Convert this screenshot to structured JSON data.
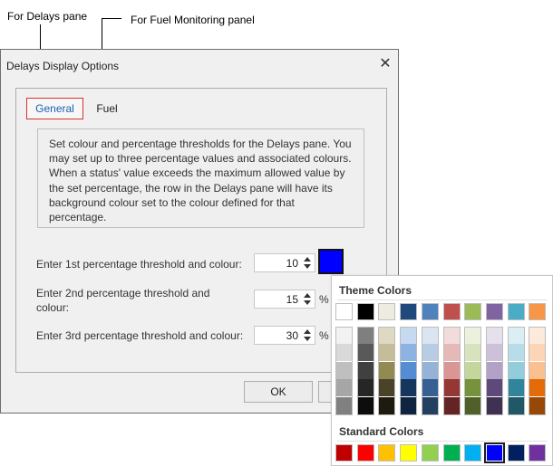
{
  "callouts": {
    "delays": "For Delays pane",
    "fuel": "For Fuel Monitoring panel"
  },
  "dialog": {
    "title": "Delays Display Options",
    "close_icon": "close-icon",
    "tabs": [
      {
        "label": "General",
        "active": true
      },
      {
        "label": "Fuel",
        "active": false
      }
    ],
    "info_text": "Set colour and percentage thresholds for the Delays pane. You may set up to three percentage values and associated colours. When a status' value exceeds the maximum allowed value by the set percentage, the row in the Delays pane will have its background colour set to the colour defined for that percentage.",
    "thresholds": [
      {
        "label": "Enter 1st percentage threshold and colour:",
        "value": "10",
        "unit": "%",
        "color": "#0000ff"
      },
      {
        "label": "Enter 2nd percentage threshold and colour:",
        "value": "15",
        "unit": "%"
      },
      {
        "label": "Enter 3rd percentage threshold and colour:",
        "value": "30",
        "unit": "%"
      }
    ],
    "ok_label": "OK"
  },
  "color_picker": {
    "theme_heading": "Theme Colors",
    "standard_heading": "Standard Colors",
    "theme_row": [
      "#ffffff",
      "#000000",
      "#eeece1",
      "#1f497d",
      "#4f81bd",
      "#c0504d",
      "#9bbb59",
      "#8064a2",
      "#4bacc6",
      "#f79646"
    ],
    "theme_shades": [
      [
        "#f2f2f2",
        "#d9d9d9",
        "#bfbfbf",
        "#a6a6a6",
        "#808080"
      ],
      [
        "#7f7f7f",
        "#595959",
        "#404040",
        "#262626",
        "#0d0d0d"
      ],
      [
        "#ddd9c3",
        "#c4bd97",
        "#938953",
        "#494429",
        "#1d1b10"
      ],
      [
        "#c6d9f0",
        "#8db3e2",
        "#548dd4",
        "#17365d",
        "#0f243e"
      ],
      [
        "#dbe5f1",
        "#b8cce4",
        "#95b3d7",
        "#366092",
        "#244061"
      ],
      [
        "#f2dcdb",
        "#e5b9b7",
        "#d99694",
        "#953734",
        "#632423"
      ],
      [
        "#ebf1dd",
        "#d7e3bc",
        "#c3d69b",
        "#76923c",
        "#4f6128"
      ],
      [
        "#e5e0ec",
        "#ccc1d9",
        "#b2a2c7",
        "#5f497a",
        "#3f3151"
      ],
      [
        "#dbeef3",
        "#b7dde8",
        "#92cddc",
        "#31859b",
        "#205867"
      ],
      [
        "#fdeada",
        "#fbd5b5",
        "#fac08f",
        "#e36c09",
        "#974806"
      ]
    ],
    "standard_row": [
      "#c00000",
      "#ff0000",
      "#ffc000",
      "#ffff00",
      "#92d050",
      "#00b050",
      "#00b0f0",
      "#0000ff",
      "#002060",
      "#7030a0"
    ],
    "selected_standard_index": 7
  }
}
